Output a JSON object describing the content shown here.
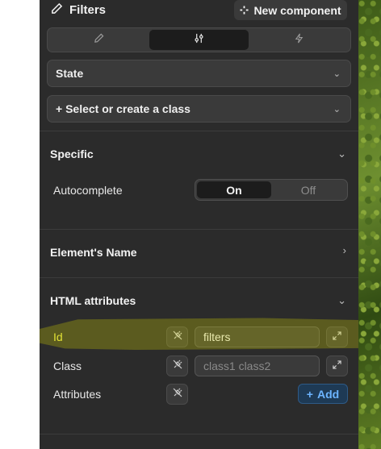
{
  "header": {
    "title": "Filters",
    "new_component_label": "New component"
  },
  "tabs": [
    {
      "icon": "brush-icon",
      "active": false
    },
    {
      "icon": "sliders-icon",
      "active": true
    },
    {
      "icon": "lightning-icon",
      "active": false
    }
  ],
  "state_dropdown": {
    "label": "State"
  },
  "class_dropdown": {
    "label": "+ Select or create a class"
  },
  "specific": {
    "title": "Specific",
    "autocomplete_label": "Autocomplete",
    "toggle_on": "On",
    "toggle_off": "Off",
    "selected": "On"
  },
  "element_name": {
    "title": "Element's Name"
  },
  "html_attributes": {
    "title": "HTML attributes",
    "id_label": "Id",
    "id_value": "filters",
    "class_label": "Class",
    "class_placeholder": "class1 class2",
    "attributes_label": "Attributes",
    "add_label": "Add"
  },
  "colors": {
    "panel_bg": "#2b2b2b",
    "accent_blue": "#6cb4ff",
    "highlight_yellow": "#d6d600"
  }
}
